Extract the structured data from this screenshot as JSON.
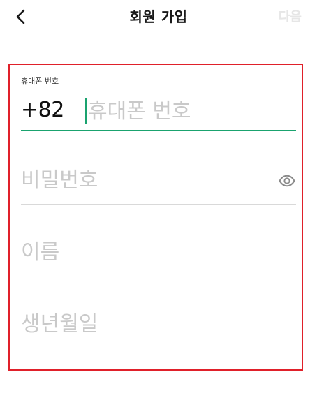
{
  "header": {
    "back_icon": "chevron-left-icon",
    "title": "회원 가입",
    "next_label": "다음"
  },
  "form": {
    "phone": {
      "label": "휴대폰 번호",
      "country_code": "+82",
      "placeholder": "휴대폰 번호",
      "value": ""
    },
    "password": {
      "placeholder": "비밀번호",
      "value": "",
      "toggle_icon": "eye-icon"
    },
    "name": {
      "placeholder": "이름",
      "value": ""
    },
    "birthdate": {
      "placeholder": "생년월일",
      "value": ""
    }
  },
  "colors": {
    "accent": "#1aa36f",
    "highlight_border": "#e0202a",
    "placeholder": "#c9c9c9",
    "next_disabled": "#e6e6e6"
  }
}
